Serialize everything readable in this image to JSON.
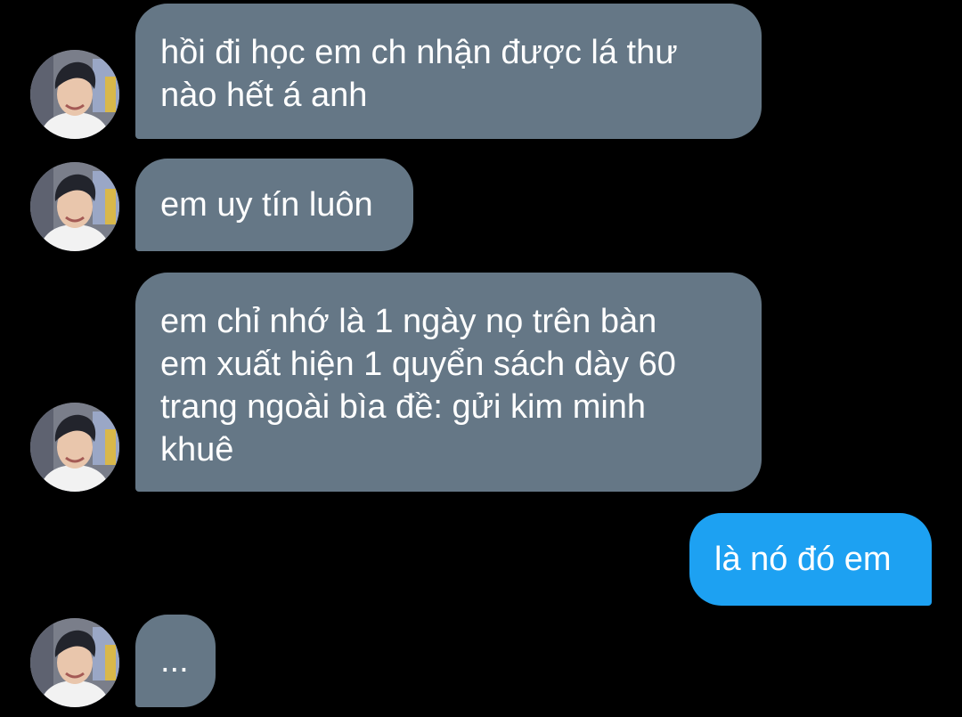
{
  "conversation": {
    "messages": [
      {
        "direction": "incoming",
        "text": "hồi đi học em ch nhận được lá thư\nnào hết á anh"
      },
      {
        "direction": "incoming",
        "text": "em uy tín luôn"
      },
      {
        "direction": "incoming",
        "text": "em chỉ nhớ là 1 ngày nọ trên bàn\nem xuất hiện 1 quyển sách dày 60\ntrang ngoài bìa đề: gửi kim minh\nkhuê"
      },
      {
        "direction": "outgoing",
        "text": "là nó đó em"
      },
      {
        "direction": "incoming",
        "text": "..."
      }
    ]
  },
  "colors": {
    "background": "#000000",
    "incoming_bubble": "#657786",
    "outgoing_bubble": "#1da1f2",
    "text": "#ffffff"
  },
  "icons": {
    "avatar": "contact-avatar-photo"
  }
}
